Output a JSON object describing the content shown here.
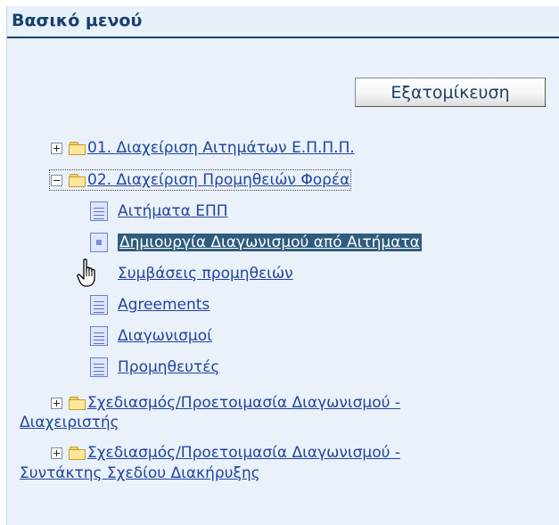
{
  "panel": {
    "title": "Βασικό μενού",
    "personalize_label": "Εξατομίκευση"
  },
  "tree": {
    "folder_1": "01. Διαχείριση Αιτημάτων Ε.Π.Π.Π.",
    "folder_2": "02. Διαχείριση Προμηθειών Φορέα",
    "items": [
      "Αιτήματα ΕΠΠ",
      "Δημιουργία Διαγωνισμού από Αιτήματα",
      "Συμβάσεις προμηθειών",
      "Agreements",
      "Διαγωνισμοί",
      "Προμηθευτές"
    ],
    "folder_3_line1": "Σχεδιασμός/Προετοιμασία Διαγωνισμού -",
    "folder_3_line2": "Διαχειριστής",
    "folder_4_line1": "Σχεδιασμός/Προετοιμασία Διαγωνισμού -",
    "folder_4_line2": "Συντάκτης Σχεδίου Διακήρυξης"
  },
  "icons": {
    "expand": "plus-box-icon",
    "collapse": "minus-box-icon",
    "folder": "folder-icon",
    "page": "document-icon",
    "cursor": "hand-pointer-icon"
  },
  "colors": {
    "header_text": "#15406e",
    "link": "#22449d",
    "selected_bg": "#2f5c7d"
  }
}
